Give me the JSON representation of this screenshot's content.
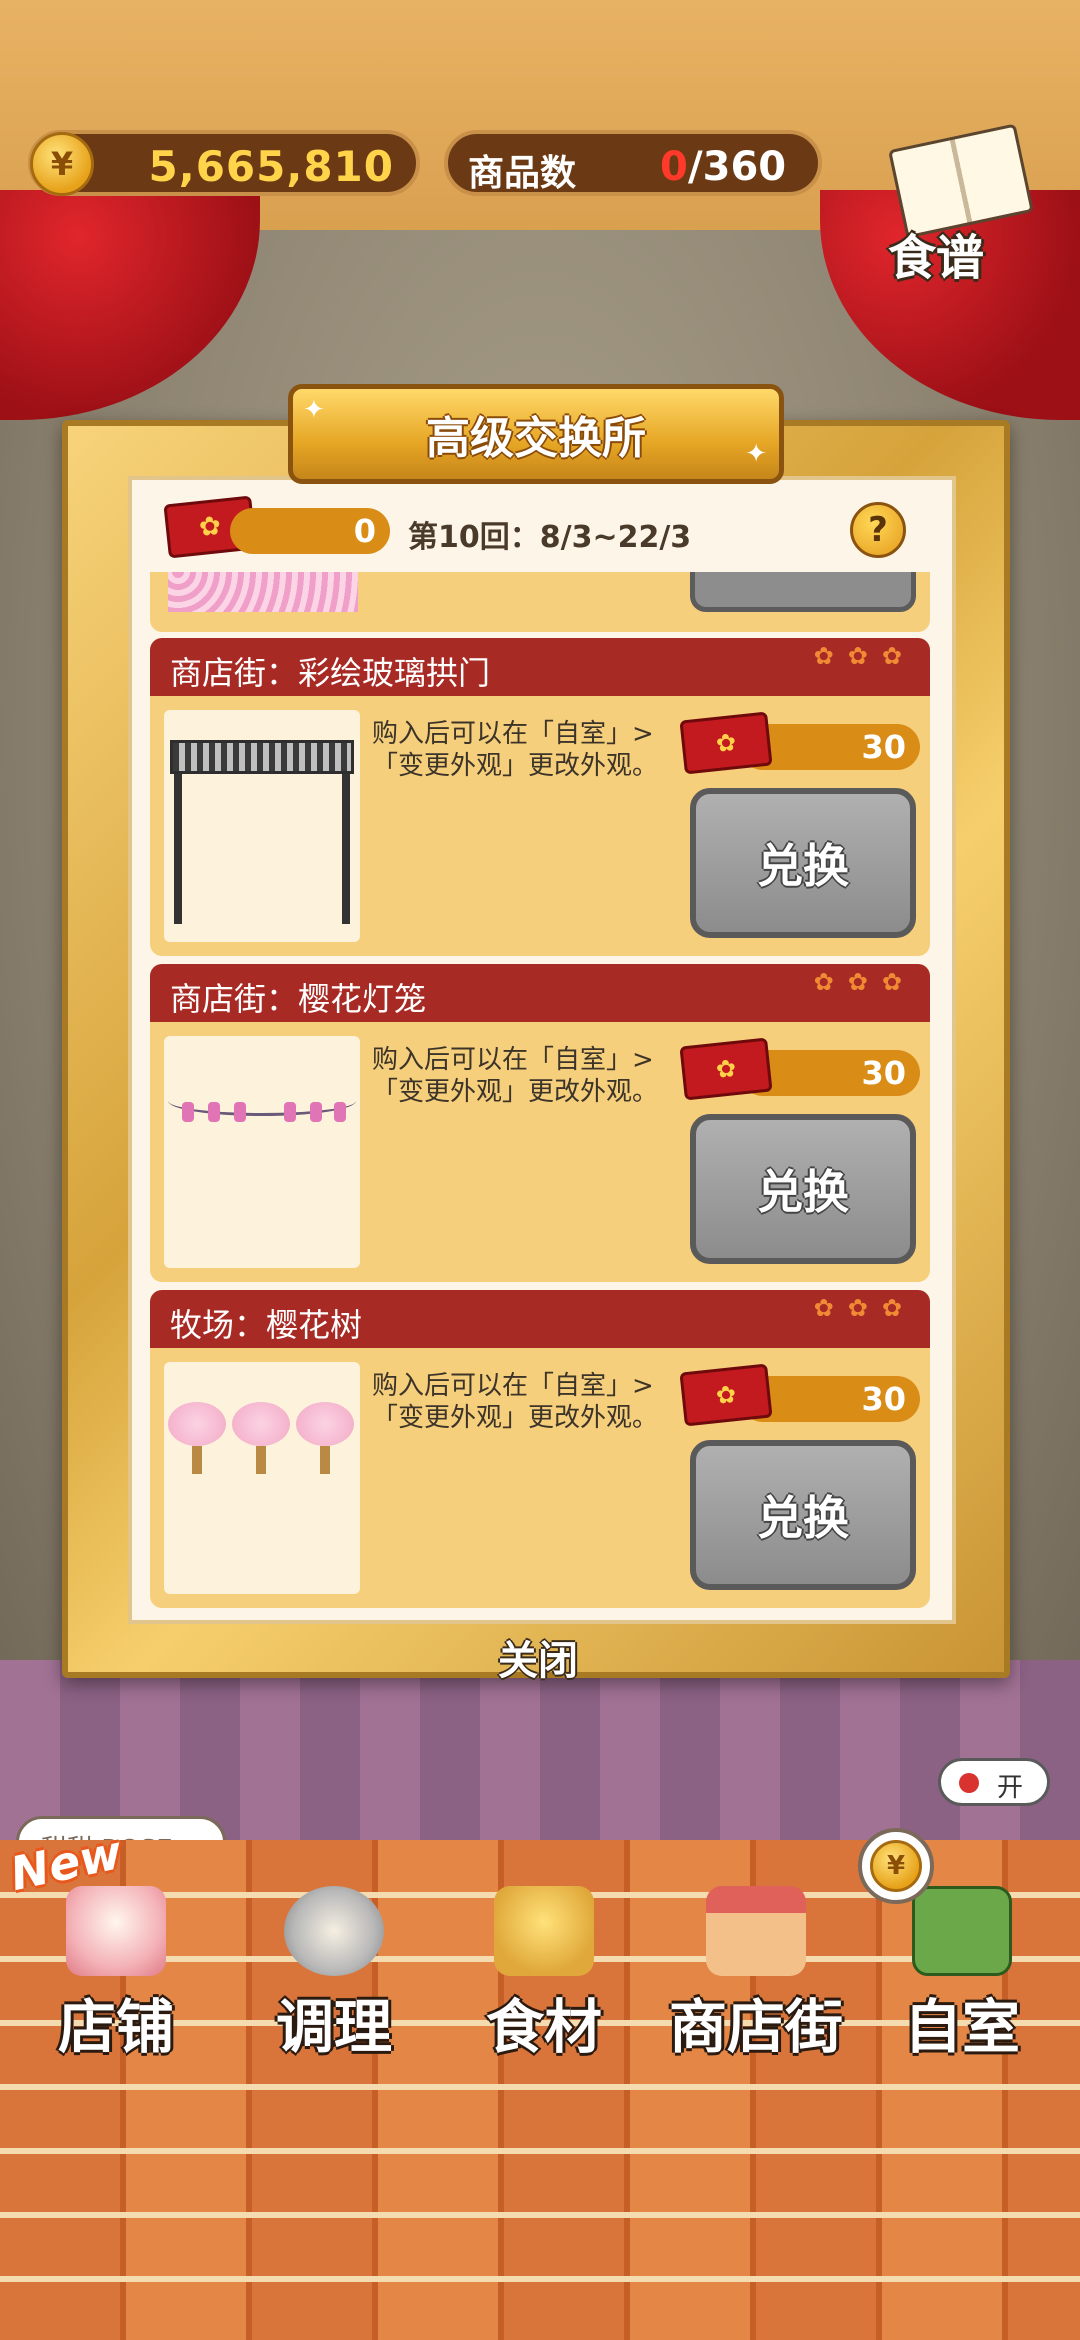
{
  "topbar": {
    "coin_symbol": "¥",
    "money": "5,665,810",
    "items_label": "商品数",
    "items_count": "0",
    "items_total": "/360",
    "recipe_label": "食谱"
  },
  "dialog": {
    "title": "高级交换所",
    "ticket_count": "0",
    "round": "第10回：8/3~22/3",
    "help": "?",
    "close": "关闭"
  },
  "cards": [
    {
      "title": "商店街：彩绘玻璃拱门",
      "desc": "购入后可以在「自室」>「变更外观」更改外观。",
      "price": "30",
      "button": "兑换"
    },
    {
      "title": "商店街：樱花灯笼",
      "desc": "购入后可以在「自室」>「变更外观」更改外观。",
      "price": "30",
      "button": "兑换"
    },
    {
      "title": "牧场：樱花树",
      "desc": "购入后可以在「自室」>「变更外观」更改外观。",
      "price": "30",
      "button": "兑换"
    }
  ],
  "side": {
    "toggle_label": "开",
    "tag_text": "甜甜 ROSE"
  },
  "nav": {
    "new_badge": "New",
    "yen": "¥",
    "items": [
      "店铺",
      "调理",
      "食材",
      "商店街",
      "自室"
    ]
  },
  "colors": {
    "card_header": "#a82a24",
    "card_body": "#f6cf7c",
    "price_bar": "#d98c16",
    "exchange_disabled": "#8c8c8c"
  }
}
